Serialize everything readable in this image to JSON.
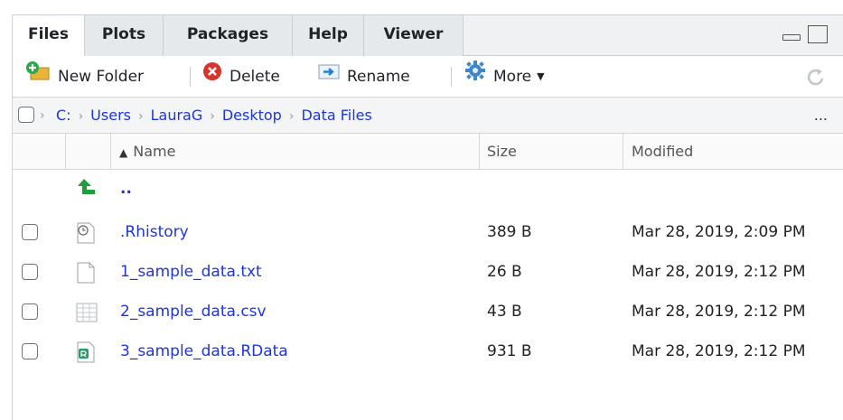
{
  "tabs": [
    {
      "label": "Files",
      "active": true
    },
    {
      "label": "Plots",
      "active": false
    },
    {
      "label": "Packages",
      "active": false
    },
    {
      "label": "Help",
      "active": false
    },
    {
      "label": "Viewer",
      "active": false
    }
  ],
  "toolbar": {
    "new_folder": "New Folder",
    "delete": "Delete",
    "rename": "Rename",
    "more": "More"
  },
  "breadcrumb": [
    "C:",
    "Users",
    "LauraG",
    "Desktop",
    "Data Files"
  ],
  "breadcrumb_more": "...",
  "columns": {
    "name": "Name",
    "size": "Size",
    "modified": "Modified"
  },
  "parent_dir_label": "..",
  "files": [
    {
      "name": ".Rhistory",
      "size": "389 B",
      "modified": "Mar 28, 2019, 2:09 PM",
      "icon": "history-file-icon"
    },
    {
      "name": "1_sample_data.txt",
      "size": "26 B",
      "modified": "Mar 28, 2019, 2:12 PM",
      "icon": "text-file-icon"
    },
    {
      "name": "2_sample_data.csv",
      "size": "43 B",
      "modified": "Mar 28, 2019, 2:12 PM",
      "icon": "csv-file-icon"
    },
    {
      "name": "3_sample_data.RData",
      "size": "931 B",
      "modified": "Mar 28, 2019, 2:12 PM",
      "icon": "rdata-file-icon"
    }
  ],
  "colors": {
    "link": "#1d36d6",
    "tab_bg": "#e6e9ec",
    "toolbar_bg": "#ffffff",
    "up_arrow": "#1e9e3b"
  }
}
